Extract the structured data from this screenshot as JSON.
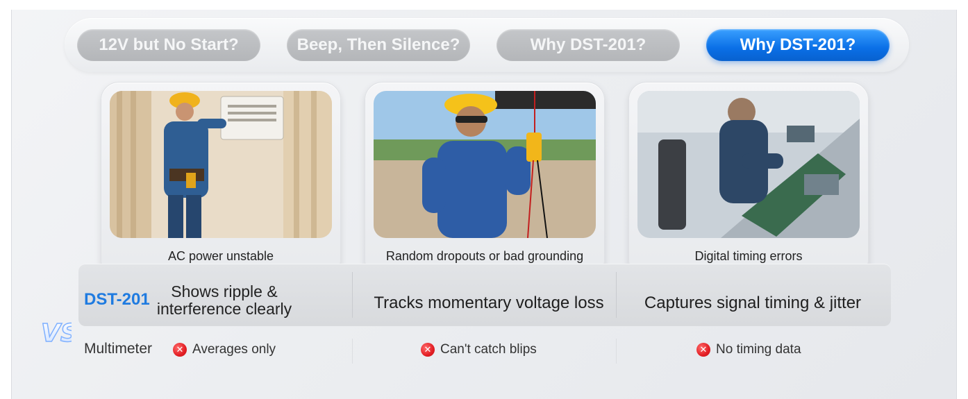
{
  "tabs": [
    {
      "label": "12V but No Start?",
      "active": false
    },
    {
      "label": "Beep, Then Silence?",
      "active": false
    },
    {
      "label": "Why DST-201?",
      "active": false
    },
    {
      "label": "Why DST-201?",
      "active": true
    }
  ],
  "cards": [
    {
      "caption": "AC power unstable",
      "photo": "technician-at-ac-unit"
    },
    {
      "caption": "Random dropouts or  bad grounding",
      "photo": "technician-with-multimeter-probes"
    },
    {
      "caption": "Digital timing errors",
      "photo": "engineer-at-circuit-board-bench"
    }
  ],
  "compare": {
    "dst_label": "DST-201",
    "dst": [
      "Shows ripple & interference clearly",
      "Tracks momentary voltage loss",
      "Captures signal timing & jitter"
    ],
    "vs_label": "VS",
    "multimeter_label": "Multimeter",
    "multimeter": [
      "Averages only",
      "Can't catch blips",
      "No timing data"
    ]
  },
  "colors": {
    "accent": "#0a6fe6",
    "dst_label": "#1f7be0",
    "bad": "#e31e24"
  }
}
